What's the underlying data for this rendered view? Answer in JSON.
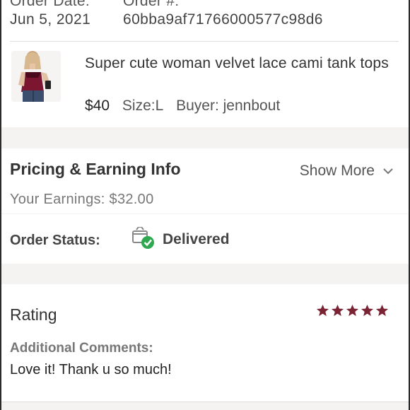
{
  "order": {
    "date_label": "Order Date:",
    "date_value": "Jun 5, 2021",
    "number_label": "Order #:",
    "number_value": "60bba9af71766000577c98d6"
  },
  "item": {
    "title": "Super cute woman velvet lace cami tank tops",
    "price": "$40",
    "size": "Size:L",
    "buyer": "Buyer: jennbout"
  },
  "pricing": {
    "title": "Pricing & Earning Info",
    "show_more": "Show More",
    "earnings": "Your Earnings: $32.00"
  },
  "status": {
    "label": "Order Status:",
    "value": "Delivered"
  },
  "rating": {
    "title": "Rating",
    "stars": 5,
    "comments_label": "Additional Comments:",
    "comments_text": "Love it! Thank u so much!"
  },
  "colors": {
    "star": "#7a2433",
    "check": "#2fa84f"
  },
  "icons": {
    "chevron": "chevron-down-icon",
    "status": "delivered-box-icon",
    "star": "star-icon"
  }
}
